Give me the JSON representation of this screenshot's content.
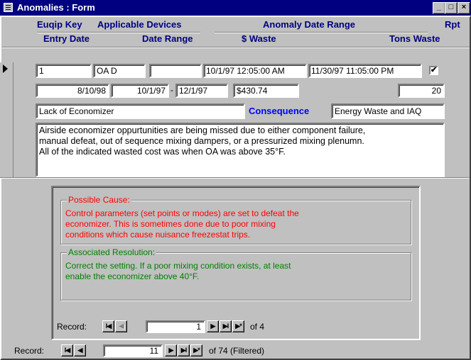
{
  "window": {
    "title": "Anomalies : Form",
    "controls": [
      "_",
      "□",
      "×"
    ]
  },
  "header": {
    "equip_key": "Euqip Key",
    "applicable_devices": "Applicable Devices",
    "anomaly_date_range": "Anomaly Date Range",
    "rpt": "Rpt",
    "entry_date": "Entry Date",
    "date_range": "Date Range",
    "waste": "$ Waste",
    "tons_waste": "Tons Waste"
  },
  "record": {
    "equip_key": "1",
    "applicable_devices": "OA D",
    "blank_field": "",
    "anomaly_start": "10/1/97 12:05:00 AM",
    "anomaly_end": "11/30/97 11:05:00 PM",
    "rpt_checked": "✔",
    "entry_date": "8/10/98",
    "date_range_start": "10/1/97",
    "date_range_sep": "-",
    "date_range_end": "12/1/97",
    "waste": "$430.74",
    "tons_waste": "20",
    "anomaly": "Lack of Economizer",
    "consequence_label": "Consequence",
    "consequence": "Energy Waste and IAQ",
    "description": "Airside economizer oppurtunities are being missed due to either component failure,\nmanual defeat, out of sequence mixing dampers, or a pressurized mixing plenumn.\nAll of the indicated wasted cost was when OA was above 35°F."
  },
  "subform": {
    "possible_cause_label": "Possible Cause:",
    "possible_cause": "Control parameters (set points or modes) are set to defeat the\neconomizer.  This is sometimes done due to poor mixing\nconditions which cause nuisance freezestat trips.",
    "resolution_label": "Associated Resolution:",
    "resolution": "Correct the setting.  If a poor mixing condition exists, at least\nenable the economizer above 40°F.",
    "nav": {
      "label": "Record:",
      "current": "1",
      "of_text": "of  4"
    }
  },
  "main_nav": {
    "label": "Record:",
    "current": "11",
    "of_text": "of  74 (Filtered)"
  },
  "nav_buttons": {
    "first": "I◀",
    "prev": "◀",
    "next": "▶",
    "last": "▶I",
    "new": "▶*"
  },
  "colors": {
    "titlebar": "#000080",
    "label_blue": "#000080",
    "cause_red": "#ff0000",
    "resolution_green": "#008000",
    "face": "#c0c0c0"
  }
}
